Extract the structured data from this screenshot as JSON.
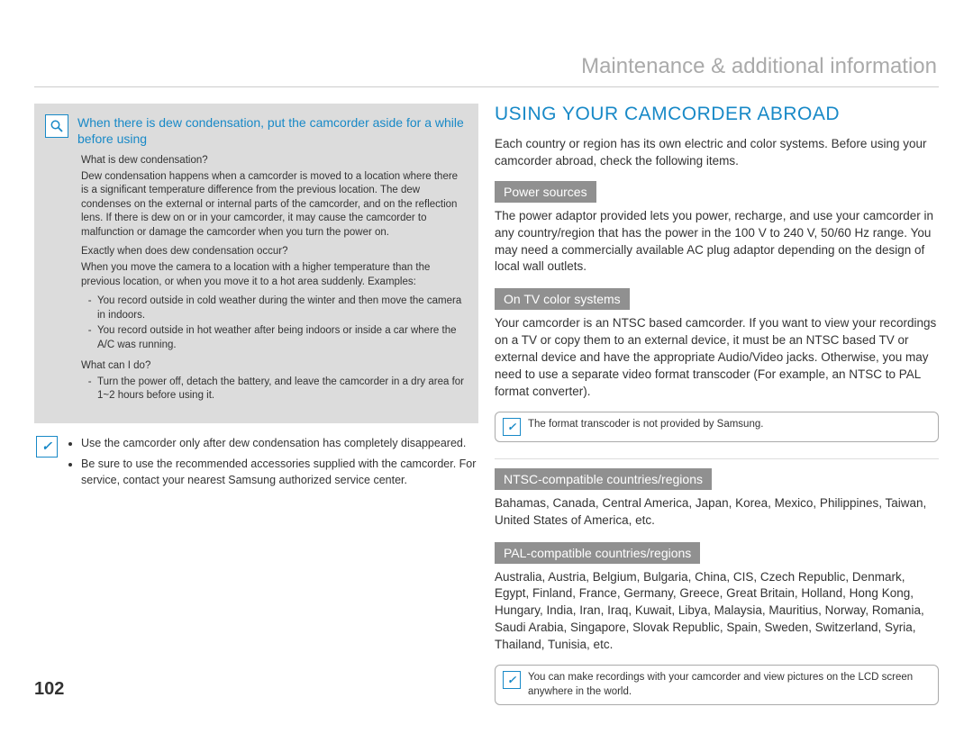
{
  "header": {
    "title": "Maintenance & additional information"
  },
  "page_number": "102",
  "left": {
    "dew_heading": "When there is dew condensation, put the camcorder aside for a while before using",
    "q1": "What is dew condensation?",
    "a1": "Dew condensation happens when a camcorder is moved to a location where there is a significant temperature difference from the previous location. The dew condenses on the external or internal parts of the camcorder, and on the reflection lens. If there is dew on or in your camcorder, it may cause the camcorder to malfunction or damage the camcorder when you turn the power on.",
    "q2": "Exactly when does dew condensation occur?",
    "a2_intro": "When you move the camera to a location with a higher temperature than the previous location, or when you move it to a hot area suddenly. Examples:",
    "a2_li1": "You record outside in cold weather during the winter and then move the camera in indoors.",
    "a2_li2": "You record outside in hot weather after being indoors or inside a car where the A/C was running.",
    "q3": "What can I do?",
    "a3_li1": "Turn the power off, detach the battery, and leave the camcorder in a dry area for 1~2 hours before using it.",
    "note_li1": "Use the camcorder only after dew condensation has completely disappeared.",
    "note_li2": "Be sure to use the recommended accessories supplied with the camcorder. For service, contact your nearest Samsung authorized service center."
  },
  "right": {
    "title": "USING YOUR CAMCORDER ABROAD",
    "intro": "Each country or region has its own electric and color systems. Before using your camcorder abroad, check the following items.",
    "power_tag": "Power sources",
    "power_body": "The power adaptor provided lets you power, recharge, and use your camcorder in any country/region that has the power in the 100 V to 240 V, 50/60 Hz range. You may need a commercially available AC plug adaptor depending on the design of local wall outlets.",
    "tv_tag": "On TV color systems",
    "tv_body": "Your camcorder is an NTSC based camcorder. If you want to view your recordings on a TV or copy them to an external device, it must be an NTSC based TV or external device and have the appropriate Audio/Video jacks. Otherwise, you may need to use a separate video format transcoder (For example, an NTSC to PAL format converter).",
    "tv_note": "The format transcoder is not provided by Samsung.",
    "ntsc_tag": "NTSC-compatible countries/regions",
    "ntsc_body": "Bahamas, Canada, Central America, Japan, Korea, Mexico, Philippines, Taiwan, United States of America, etc.",
    "pal_tag": "PAL-compatible countries/regions",
    "pal_body": "Australia, Austria, Belgium, Bulgaria, China, CIS, Czech Republic, Denmark, Egypt, Finland, France, Germany, Greece, Great Britain, Holland, Hong Kong, Hungary, India, Iran, Iraq, Kuwait, Libya, Malaysia, Mauritius, Norway, Romania, Saudi Arabia, Singapore, Slovak Republic, Spain, Sweden, Switzerland, Syria, Thailand, Tunisia, etc.",
    "pal_note": "You can make recordings with your camcorder and view pictures on the LCD screen anywhere in the world."
  }
}
